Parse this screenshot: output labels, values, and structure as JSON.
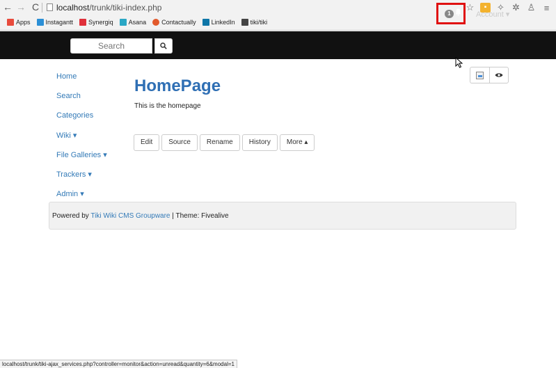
{
  "browser": {
    "url_host": "localhost",
    "url_path": "/trunk/tiki-index.php",
    "bookmarks": [
      {
        "label": "Apps",
        "color": "#e84b3c"
      },
      {
        "label": "Instagantt",
        "color": "#2b8fd6"
      },
      {
        "label": "Synergiq",
        "color": "#e0303a"
      },
      {
        "label": "Asana",
        "color": "#2aa7c5"
      },
      {
        "label": "Contactually",
        "color": "#e25a2c"
      },
      {
        "label": "LinkedIn",
        "color": "#0e76a8"
      },
      {
        "label": "tiki/tiki",
        "color": "#444444"
      }
    ],
    "status_url": "localhost/trunk/tiki-ajax_services.php?controller=monitor&action=unread&quantity=6&modal=1"
  },
  "topbar": {
    "search_placeholder": "Search",
    "notification_count": "1",
    "account_label": "Account ▾"
  },
  "sidebar": {
    "items": [
      {
        "label": "Home"
      },
      {
        "label": "Search"
      },
      {
        "label": "Categories"
      },
      {
        "label": "Wiki ▾"
      },
      {
        "label": "File Galleries ▾"
      },
      {
        "label": "Trackers ▾"
      },
      {
        "label": "Admin ▾"
      }
    ]
  },
  "page": {
    "title": "HomePage",
    "description": "This is the homepage"
  },
  "actions": {
    "edit": "Edit",
    "source": "Source",
    "rename": "Rename",
    "history": "History",
    "more": "More ▴"
  },
  "footer": {
    "powered_by": "Powered by ",
    "cms_link": "Tiki Wiki CMS Groupware",
    "theme": " | Theme: Fivealive"
  },
  "colors": {
    "navbar": "#111111",
    "link": "#337ab7",
    "title": "#2f6fb4",
    "highlight": "#e01010"
  }
}
